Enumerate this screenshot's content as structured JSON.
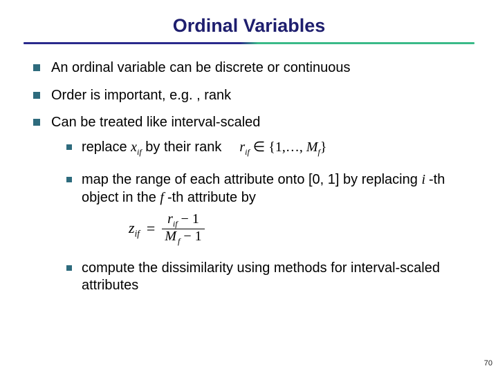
{
  "title": "Ordinal Variables",
  "bullets": {
    "b1": "An ordinal variable can be discrete or continuous",
    "b2": "Order is important, e.g. , rank",
    "b3": "Can be treated like interval-scaled",
    "s1_pre": "replace ",
    "s1_var": "x",
    "s1_sub": "if",
    "s1_post": "  by their rank",
    "s1_set_lhs": "r",
    "s1_set_sub": "if",
    "s1_set_in": " ∈ {1,…, ",
    "s1_set_M": "M",
    "s1_set_Msub": "f",
    "s1_set_close": "}",
    "s2a": "map the range of each attribute onto [0, 1] by replacing ",
    "s2_i": "i ",
    "s2b": "-th object in the ",
    "s2_f": "f ",
    "s2c": "-th attribute by",
    "formula": {
      "z": "z",
      "zsub": "if",
      "eq": "=",
      "num_r": "r",
      "num_rsub": "if",
      "num_minus1": " − 1",
      "den_M": "M",
      "den_Msub": "f",
      "den_minus1": " − 1"
    },
    "s3": "compute the dissimilarity using methods for interval-scaled attributes"
  },
  "page_number": "70"
}
